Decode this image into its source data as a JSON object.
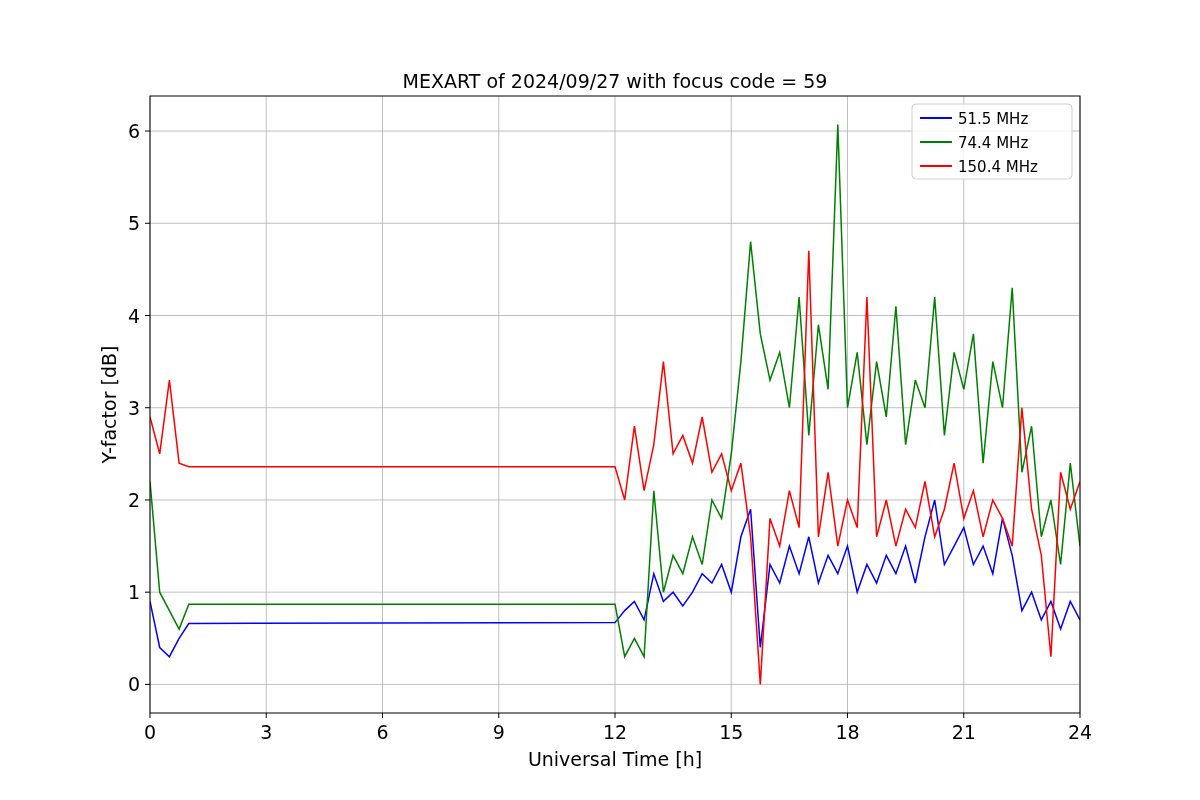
{
  "chart_data": {
    "type": "line",
    "title": "MEXART of 2024/09/27 with focus code = 59",
    "xlabel": "Universal Time [h]",
    "ylabel": "Y-factor [dB]",
    "x": [
      0,
      0.25,
      0.5,
      0.75,
      1,
      12,
      12.25,
      12.5,
      12.75,
      13,
      13.25,
      13.5,
      13.75,
      14,
      14.25,
      14.5,
      14.75,
      15,
      15.25,
      15.5,
      15.75,
      16,
      16.25,
      16.5,
      16.75,
      17,
      17.25,
      17.5,
      17.75,
      18,
      18.25,
      18.5,
      18.75,
      19,
      19.25,
      19.5,
      19.75,
      20,
      20.25,
      20.5,
      20.75,
      21,
      21.25,
      21.5,
      21.75,
      22,
      22.25,
      22.5,
      22.75,
      23,
      23.25,
      23.5,
      23.75,
      24
    ],
    "series": [
      {
        "name": "51.5 MHz",
        "color": "#0000ff",
        "values": [
          0.9,
          0.4,
          0.3,
          0.5,
          0.66,
          0.67,
          0.8,
          0.9,
          0.7,
          1.2,
          0.9,
          1.0,
          0.85,
          1.0,
          1.2,
          1.1,
          1.3,
          1.0,
          1.6,
          1.9,
          0.4,
          1.3,
          1.1,
          1.5,
          1.2,
          1.6,
          1.1,
          1.4,
          1.2,
          1.5,
          1.0,
          1.3,
          1.1,
          1.4,
          1.2,
          1.5,
          1.1,
          1.6,
          2.0,
          1.3,
          1.5,
          1.7,
          1.3,
          1.5,
          1.2,
          1.8,
          1.4,
          0.8,
          1.0,
          0.7,
          0.9,
          0.6,
          0.9,
          0.7
        ]
      },
      {
        "name": "74.4 MHz",
        "color": "#008000",
        "values": [
          2.2,
          1.0,
          0.8,
          0.6,
          0.87,
          0.87,
          0.3,
          0.5,
          0.3,
          2.1,
          1.0,
          1.4,
          1.2,
          1.6,
          1.3,
          2.0,
          1.8,
          2.5,
          3.5,
          4.8,
          3.8,
          3.3,
          3.6,
          3.0,
          4.2,
          2.7,
          3.9,
          3.2,
          6.07,
          3.0,
          3.6,
          2.6,
          3.5,
          2.9,
          4.1,
          2.6,
          3.3,
          3.0,
          4.2,
          2.7,
          3.6,
          3.2,
          3.8,
          2.4,
          3.5,
          3.0,
          4.3,
          2.3,
          2.8,
          1.6,
          2.0,
          1.3,
          2.4,
          1.5
        ]
      },
      {
        "name": "150.4 MHz",
        "color": "#ff0000",
        "values": [
          2.9,
          2.5,
          3.3,
          2.4,
          2.36,
          2.36,
          2.0,
          2.8,
          2.1,
          2.6,
          3.5,
          2.5,
          2.7,
          2.4,
          2.9,
          2.3,
          2.5,
          2.1,
          2.4,
          1.6,
          0.0,
          1.8,
          1.5,
          2.1,
          1.7,
          4.7,
          1.6,
          2.3,
          1.5,
          2.0,
          1.7,
          4.2,
          1.6,
          2.0,
          1.5,
          1.9,
          1.7,
          2.2,
          1.6,
          1.9,
          2.4,
          1.8,
          2.1,
          1.6,
          2.0,
          1.8,
          1.5,
          3.0,
          1.9,
          1.4,
          0.3,
          2.3,
          1.9,
          2.2
        ]
      }
    ],
    "xlim": [
      0,
      24
    ],
    "ylim": [
      -0.31,
      6.38
    ],
    "xticks": [
      0,
      3,
      6,
      9,
      12,
      15,
      18,
      21,
      24
    ],
    "yticks": [
      0,
      1,
      2,
      3,
      4,
      5,
      6
    ],
    "grid": true,
    "legend": "upper right"
  }
}
